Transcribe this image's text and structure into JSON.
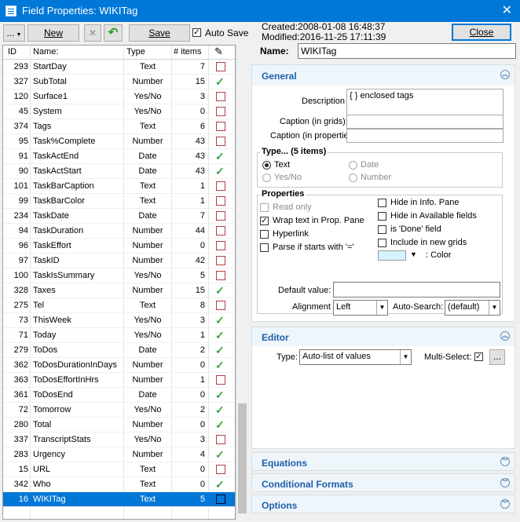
{
  "title": "Field Properties: WIKITag",
  "toolbar": {
    "menu_label": "...",
    "new_label": "New",
    "save_label": "Save",
    "autosave_label": "Auto Save",
    "autosave_checked": true
  },
  "meta": {
    "created": "Created:2008-01-08 16:48:37",
    "modified": "Modified:2016-11-25 17:11:39"
  },
  "close_label": "Close",
  "grid": {
    "headers": {
      "id": "ID",
      "name": "Name:",
      "type": "Type",
      "items": "# items"
    },
    "rows": [
      {
        "id": "293",
        "name": "StartDay",
        "type": "Text",
        "items": "7",
        "check": false
      },
      {
        "id": "327",
        "name": "SubTotal",
        "type": "Number",
        "items": "15",
        "check": true
      },
      {
        "id": "120",
        "name": "Surface1",
        "type": "Yes/No",
        "items": "3",
        "check": false
      },
      {
        "id": "45",
        "name": "System",
        "type": "Yes/No",
        "items": "0",
        "check": false
      },
      {
        "id": "374",
        "name": "Tags",
        "type": "Text",
        "items": "6",
        "check": false
      },
      {
        "id": "95",
        "name": "Task%Complete",
        "type": "Number",
        "items": "43",
        "check": false
      },
      {
        "id": "91",
        "name": "TaskActEnd",
        "type": "Date",
        "items": "43",
        "check": true
      },
      {
        "id": "90",
        "name": "TaskActStart",
        "type": "Date",
        "items": "43",
        "check": true
      },
      {
        "id": "101",
        "name": "TaskBarCaption",
        "type": "Text",
        "items": "1",
        "check": false
      },
      {
        "id": "99",
        "name": "TaskBarColor",
        "type": "Text",
        "items": "1",
        "check": false
      },
      {
        "id": "234",
        "name": "TaskDate",
        "type": "Date",
        "items": "7",
        "check": false
      },
      {
        "id": "94",
        "name": "TaskDuration",
        "type": "Number",
        "items": "44",
        "check": false
      },
      {
        "id": "96",
        "name": "TaskEffort",
        "type": "Number",
        "items": "0",
        "check": false
      },
      {
        "id": "97",
        "name": "TaskID",
        "type": "Number",
        "items": "42",
        "check": false
      },
      {
        "id": "100",
        "name": "TaskIsSummary",
        "type": "Yes/No",
        "items": "5",
        "check": false
      },
      {
        "id": "328",
        "name": "Taxes",
        "type": "Number",
        "items": "15",
        "check": true
      },
      {
        "id": "275",
        "name": "Tel",
        "type": "Text",
        "items": "8",
        "check": false
      },
      {
        "id": "73",
        "name": "ThisWeek",
        "type": "Yes/No",
        "items": "3",
        "check": true
      },
      {
        "id": "71",
        "name": "Today",
        "type": "Yes/No",
        "items": "1",
        "check": true
      },
      {
        "id": "279",
        "name": "ToDos",
        "type": "Date",
        "items": "2",
        "check": true
      },
      {
        "id": "362",
        "name": "ToDosDurationInDays",
        "type": "Number",
        "items": "0",
        "check": true
      },
      {
        "id": "363",
        "name": "ToDosEffortInHrs",
        "type": "Number",
        "items": "1",
        "check": false
      },
      {
        "id": "361",
        "name": "ToDosEnd",
        "type": "Date",
        "items": "0",
        "check": true
      },
      {
        "id": "72",
        "name": "Tomorrow",
        "type": "Yes/No",
        "items": "2",
        "check": true
      },
      {
        "id": "280",
        "name": "Total",
        "type": "Number",
        "items": "0",
        "check": true
      },
      {
        "id": "337",
        "name": "TranscriptStats",
        "type": "Yes/No",
        "items": "3",
        "check": false
      },
      {
        "id": "283",
        "name": "Urgency",
        "type": "Number",
        "items": "4",
        "check": true
      },
      {
        "id": "15",
        "name": "URL",
        "type": "Text",
        "items": "0",
        "check": false
      },
      {
        "id": "342",
        "name": "Who",
        "type": "Text",
        "items": "0",
        "check": true
      },
      {
        "id": "16",
        "name": "WIKITag",
        "type": "Text",
        "items": "5",
        "check": false,
        "selected": true
      }
    ]
  },
  "props": {
    "name_label": "Name:",
    "name_value": "WIKITag",
    "general_title": "General",
    "description_label": "Description",
    "description_value": "{ } enclosed tags",
    "caption_grids_label": "Caption (in grids):",
    "caption_props_label": "Caption (in properties):",
    "type_group_title": "Type...   (5 items)",
    "type_options": [
      "Text",
      "Yes/No",
      "Date",
      "Number"
    ],
    "properties_title": "Properties",
    "read_only": "Read only",
    "wrap_text": "Wrap text in Prop. Pane",
    "hyperlink": "Hyperlink",
    "parse_if": "Parse if starts with '='",
    "hide_info": "Hide in Info. Pane",
    "hide_avail": "Hide in Available fields",
    "is_done": "is 'Done' field",
    "include_new": "Include in new grids",
    "color_label": ": Color",
    "color_value": "#d4f4fb",
    "default_label": "Default value:",
    "alignment_label": "Alignment",
    "alignment_value": "Left",
    "autosearch_label": "Auto-Search:",
    "autosearch_value": "(default)",
    "editor_title": "Editor",
    "editor_type_label": "Type:",
    "editor_type_value": "Auto-list of values",
    "multiselect_label": "Multi-Select:",
    "more_label": "...",
    "equations_title": "Equations",
    "conditional_title": "Conditional Formats",
    "options_title": "Options"
  }
}
